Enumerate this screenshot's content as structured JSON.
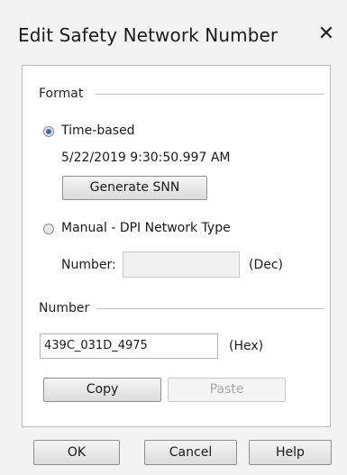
{
  "dialog": {
    "title": "Edit Safety Network Number",
    "close_glyph": "✕"
  },
  "format": {
    "group_label": "Format",
    "time_based": {
      "label": "Time-based",
      "checked": true,
      "timestamp": "5/22/2019 9:30:50.997 AM",
      "generate_button": "Generate SNN"
    },
    "manual": {
      "label": "Manual - DPI Network Type",
      "checked": false,
      "number_label": "Number:",
      "number_value": "",
      "unit": "(Dec)"
    }
  },
  "number": {
    "group_label": "Number",
    "value": "439C_031D_4975",
    "unit": "(Hex)",
    "copy_button": "Copy",
    "paste_button": "Paste"
  },
  "footer": {
    "ok": "OK",
    "cancel": "Cancel",
    "help": "Help"
  },
  "icons": [
    "close-icon",
    "radio-checked-icon",
    "radio-unchecked-icon"
  ],
  "colors": {
    "radio_accent": "#3d6fb0",
    "dialog_bg": "#f3f3f3"
  }
}
